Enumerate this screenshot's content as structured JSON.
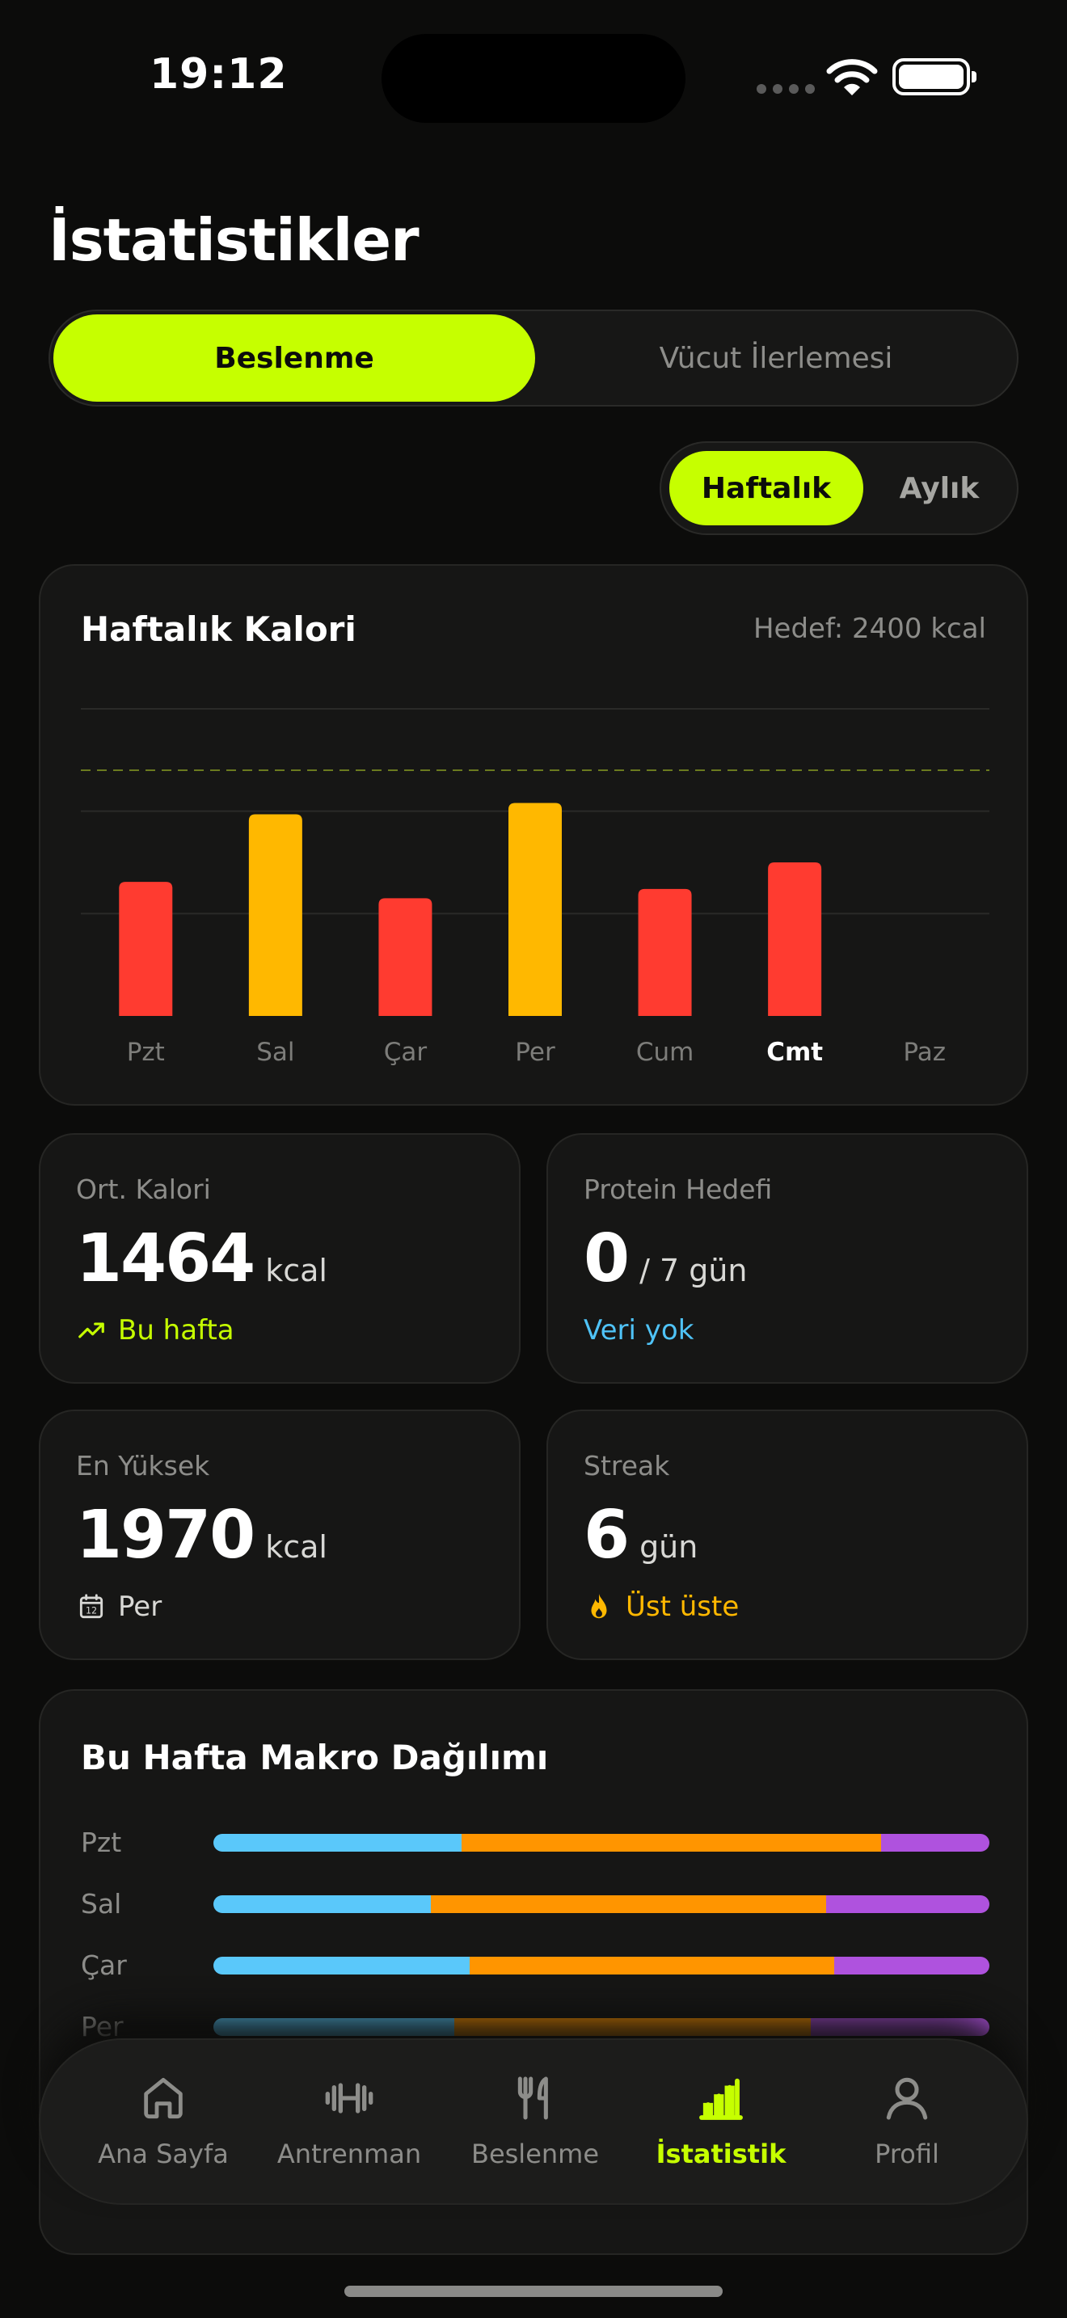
{
  "status": {
    "time": "19:12"
  },
  "page": {
    "title": "İstatistikler"
  },
  "segments": {
    "active": "Beslenme",
    "inactive": "Vücut İlerlemesi"
  },
  "period": {
    "active": "Haftalık",
    "inactive": "Aylık"
  },
  "chart_data": {
    "type": "bar",
    "title": "Haftalık Kalori",
    "goal_label": "Hedef: 2400 kcal",
    "goal": 2400,
    "ylim": [
      0,
      3000
    ],
    "grid": true,
    "categories": [
      "Pzt",
      "Sal",
      "Çar",
      "Per",
      "Cum",
      "Cmt",
      "Paz"
    ],
    "values": [
      1310,
      1970,
      1150,
      2080,
      1240,
      1500,
      0
    ],
    "bar_colors": [
      "#ff3b30",
      "#ffb800",
      "#ff3b30",
      "#ffb800",
      "#ff3b30",
      "#ff3b30",
      "#ff3b30"
    ],
    "highlight_category": "Cmt"
  },
  "stats": {
    "avg": {
      "label": "Ort. Kalori",
      "value": "1464",
      "unit": "kcal",
      "foot": "Bu hafta",
      "foot_icon": "trending-up-icon",
      "foot_color": "#c6ff00"
    },
    "protein": {
      "label": "Protein Hedefi",
      "value": "0",
      "unit": "/ 7 gün",
      "foot": "Veri yok",
      "foot_color": "#4fc3f7"
    },
    "max": {
      "label": "En Yüksek",
      "value": "1970",
      "unit": "kcal",
      "foot": "Per",
      "foot_icon": "calendar-icon",
      "foot_color": "#d8d8d5"
    },
    "streak": {
      "label": "Streak",
      "value": "6",
      "unit": "gün",
      "foot": "Üst üste",
      "foot_icon": "flame-icon",
      "foot_color": "#ffb800"
    }
  },
  "macros": {
    "title": "Bu Hafta Makro Dağılımı",
    "colors": [
      "#5ac8fa",
      "#ff9500",
      "#af52de"
    ],
    "rows": [
      {
        "day": "Pzt",
        "parts": [
          0.32,
          0.54,
          0.14
        ]
      },
      {
        "day": "Sal",
        "parts": [
          0.28,
          0.51,
          0.21
        ]
      },
      {
        "day": "Çar",
        "parts": [
          0.33,
          0.47,
          0.2
        ]
      },
      {
        "day": "Per",
        "parts": [
          0.31,
          0.46,
          0.23
        ]
      }
    ]
  },
  "tabs": [
    {
      "label": "Ana Sayfa",
      "icon": "home-icon",
      "active": false
    },
    {
      "label": "Antrenman",
      "icon": "dumbbell-icon",
      "active": false
    },
    {
      "label": "Beslenme",
      "icon": "fork-knife-icon",
      "active": false
    },
    {
      "label": "İstatistik",
      "icon": "bar-chart-icon",
      "active": true
    },
    {
      "label": "Profil",
      "icon": "user-icon",
      "active": false
    }
  ]
}
